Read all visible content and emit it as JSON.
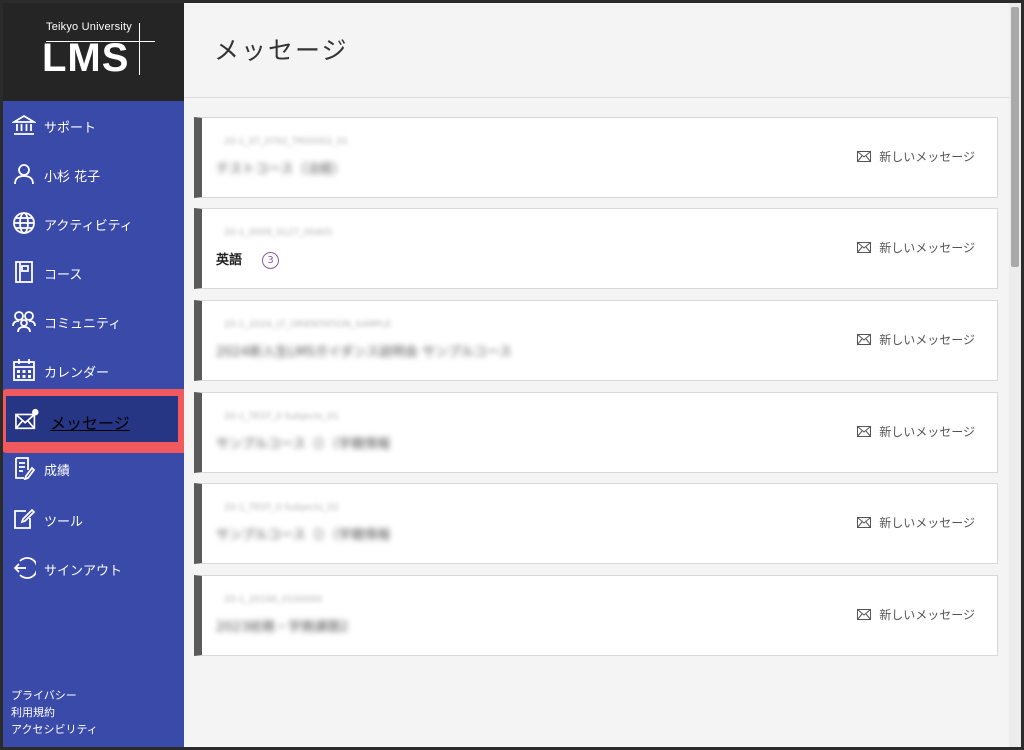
{
  "logo": {
    "university": "Teikyo University",
    "product": "LMS"
  },
  "sidebar": {
    "items": [
      {
        "label": "サポート",
        "icon": "bank-icon"
      },
      {
        "label": "小杉 花子",
        "icon": "user-icon"
      },
      {
        "label": "アクティビティ",
        "icon": "globe-icon"
      },
      {
        "label": "コース",
        "icon": "book-icon"
      },
      {
        "label": "コミュニティ",
        "icon": "people-icon"
      },
      {
        "label": "カレンダー",
        "icon": "calendar-icon"
      },
      {
        "label": "メッセージ",
        "icon": "envelope-icon",
        "active": true
      },
      {
        "label": "成績",
        "icon": "grade-icon"
      },
      {
        "label": "ツール",
        "icon": "edit-icon"
      },
      {
        "label": "サインアウト",
        "icon": "signout-icon"
      }
    ],
    "footer": [
      "プライバシー",
      "利用規約",
      "アクセシビリティ"
    ]
  },
  "page": {
    "title": "メッセージ"
  },
  "cards": [
    {
      "code": "20-1_ST_0792_TR00002_01",
      "name": "テストコース（法経）",
      "action": "新しいメッセージ",
      "blurred": true
    },
    {
      "code": "20-1_0009_0127_00405",
      "name": "英語",
      "badge": "3",
      "action": "新しいメッセージ",
      "blurred": false
    },
    {
      "code": "20-1_2024_LT_ORIENTATION_SAMPLE",
      "name": "2024新入生LMSガイダンス説明会 サンプルコース",
      "action": "新しいメッセージ",
      "blurred": true
    },
    {
      "code": "20-1_TEST_0 Subjects_01",
      "name": "サンプルコース（）（学籍情報",
      "action": "新しいメッセージ",
      "blurred": true
    },
    {
      "code": "20-1_TEST_0 Subjects_02",
      "name": "サンプルコース（）（学籍情報",
      "action": "新しいメッセージ",
      "blurred": true
    },
    {
      "code": "20-1_20190_0100000",
      "name": "2023総務・学務課題2",
      "action": "新しいメッセージ",
      "blurred": true
    }
  ]
}
